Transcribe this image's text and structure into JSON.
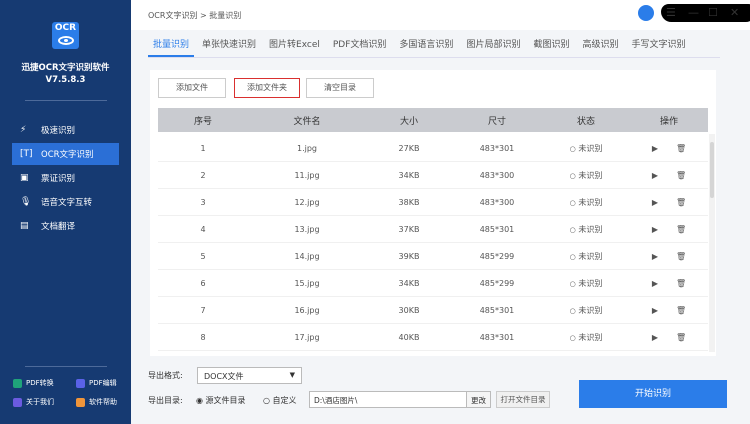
{
  "app": {
    "logo_text": "OCR",
    "name": "迅捷OCR文字识别软件",
    "version": "V7.5.8.3"
  },
  "sidebar": {
    "items": [
      {
        "label": "极速识别",
        "icon": "lightning-doc-icon"
      },
      {
        "label": "OCR文字识别",
        "icon": "text-scan-icon"
      },
      {
        "label": "票证识别",
        "icon": "ticket-icon"
      },
      {
        "label": "语音文字互转",
        "icon": "microphone-icon"
      },
      {
        "label": "文档翻译",
        "icon": "translate-doc-icon"
      }
    ],
    "footer": [
      {
        "label": "PDF转换",
        "color": "#1fa37a"
      },
      {
        "label": "PDF编辑",
        "color": "#5a62e8"
      },
      {
        "label": "关于我们",
        "color": "#6b5be0"
      },
      {
        "label": "软件帮助",
        "color": "#f0953a"
      }
    ]
  },
  "header": {
    "breadcrumb": "OCR文字识别 > 批量识别"
  },
  "tabs": [
    "批量识别",
    "单张快速识别",
    "图片转Excel",
    "PDF文档识别",
    "多国语言识别",
    "图片局部识别",
    "截图识别",
    "高级识别",
    "手写文字识别"
  ],
  "toolbar": {
    "add_file": "添加文件",
    "add_folder": "添加文件夹",
    "clear": "清空目录"
  },
  "table": {
    "headers": [
      "序号",
      "文件名",
      "大小",
      "尺寸",
      "状态",
      "操作"
    ],
    "rows": [
      [
        "1",
        "1.jpg",
        "27KB",
        "483*301",
        "未识别"
      ],
      [
        "2",
        "11.jpg",
        "34KB",
        "483*300",
        "未识别"
      ],
      [
        "3",
        "12.jpg",
        "38KB",
        "483*300",
        "未识别"
      ],
      [
        "4",
        "13.jpg",
        "37KB",
        "485*301",
        "未识别"
      ],
      [
        "5",
        "14.jpg",
        "39KB",
        "485*299",
        "未识别"
      ],
      [
        "6",
        "15.jpg",
        "34KB",
        "485*299",
        "未识别"
      ],
      [
        "7",
        "16.jpg",
        "30KB",
        "485*301",
        "未识别"
      ],
      [
        "8",
        "17.jpg",
        "40KB",
        "483*301",
        "未识别"
      ]
    ]
  },
  "export": {
    "format_label": "导出格式:",
    "format_value": "DOCX文件",
    "dir_label": "导出目录:",
    "opt_source": "源文件目录",
    "opt_custom": "自定义",
    "path": "D:\\酒店图片\\",
    "change": "更改",
    "open_dir": "打开文件目录"
  },
  "start_button": "开始识别"
}
